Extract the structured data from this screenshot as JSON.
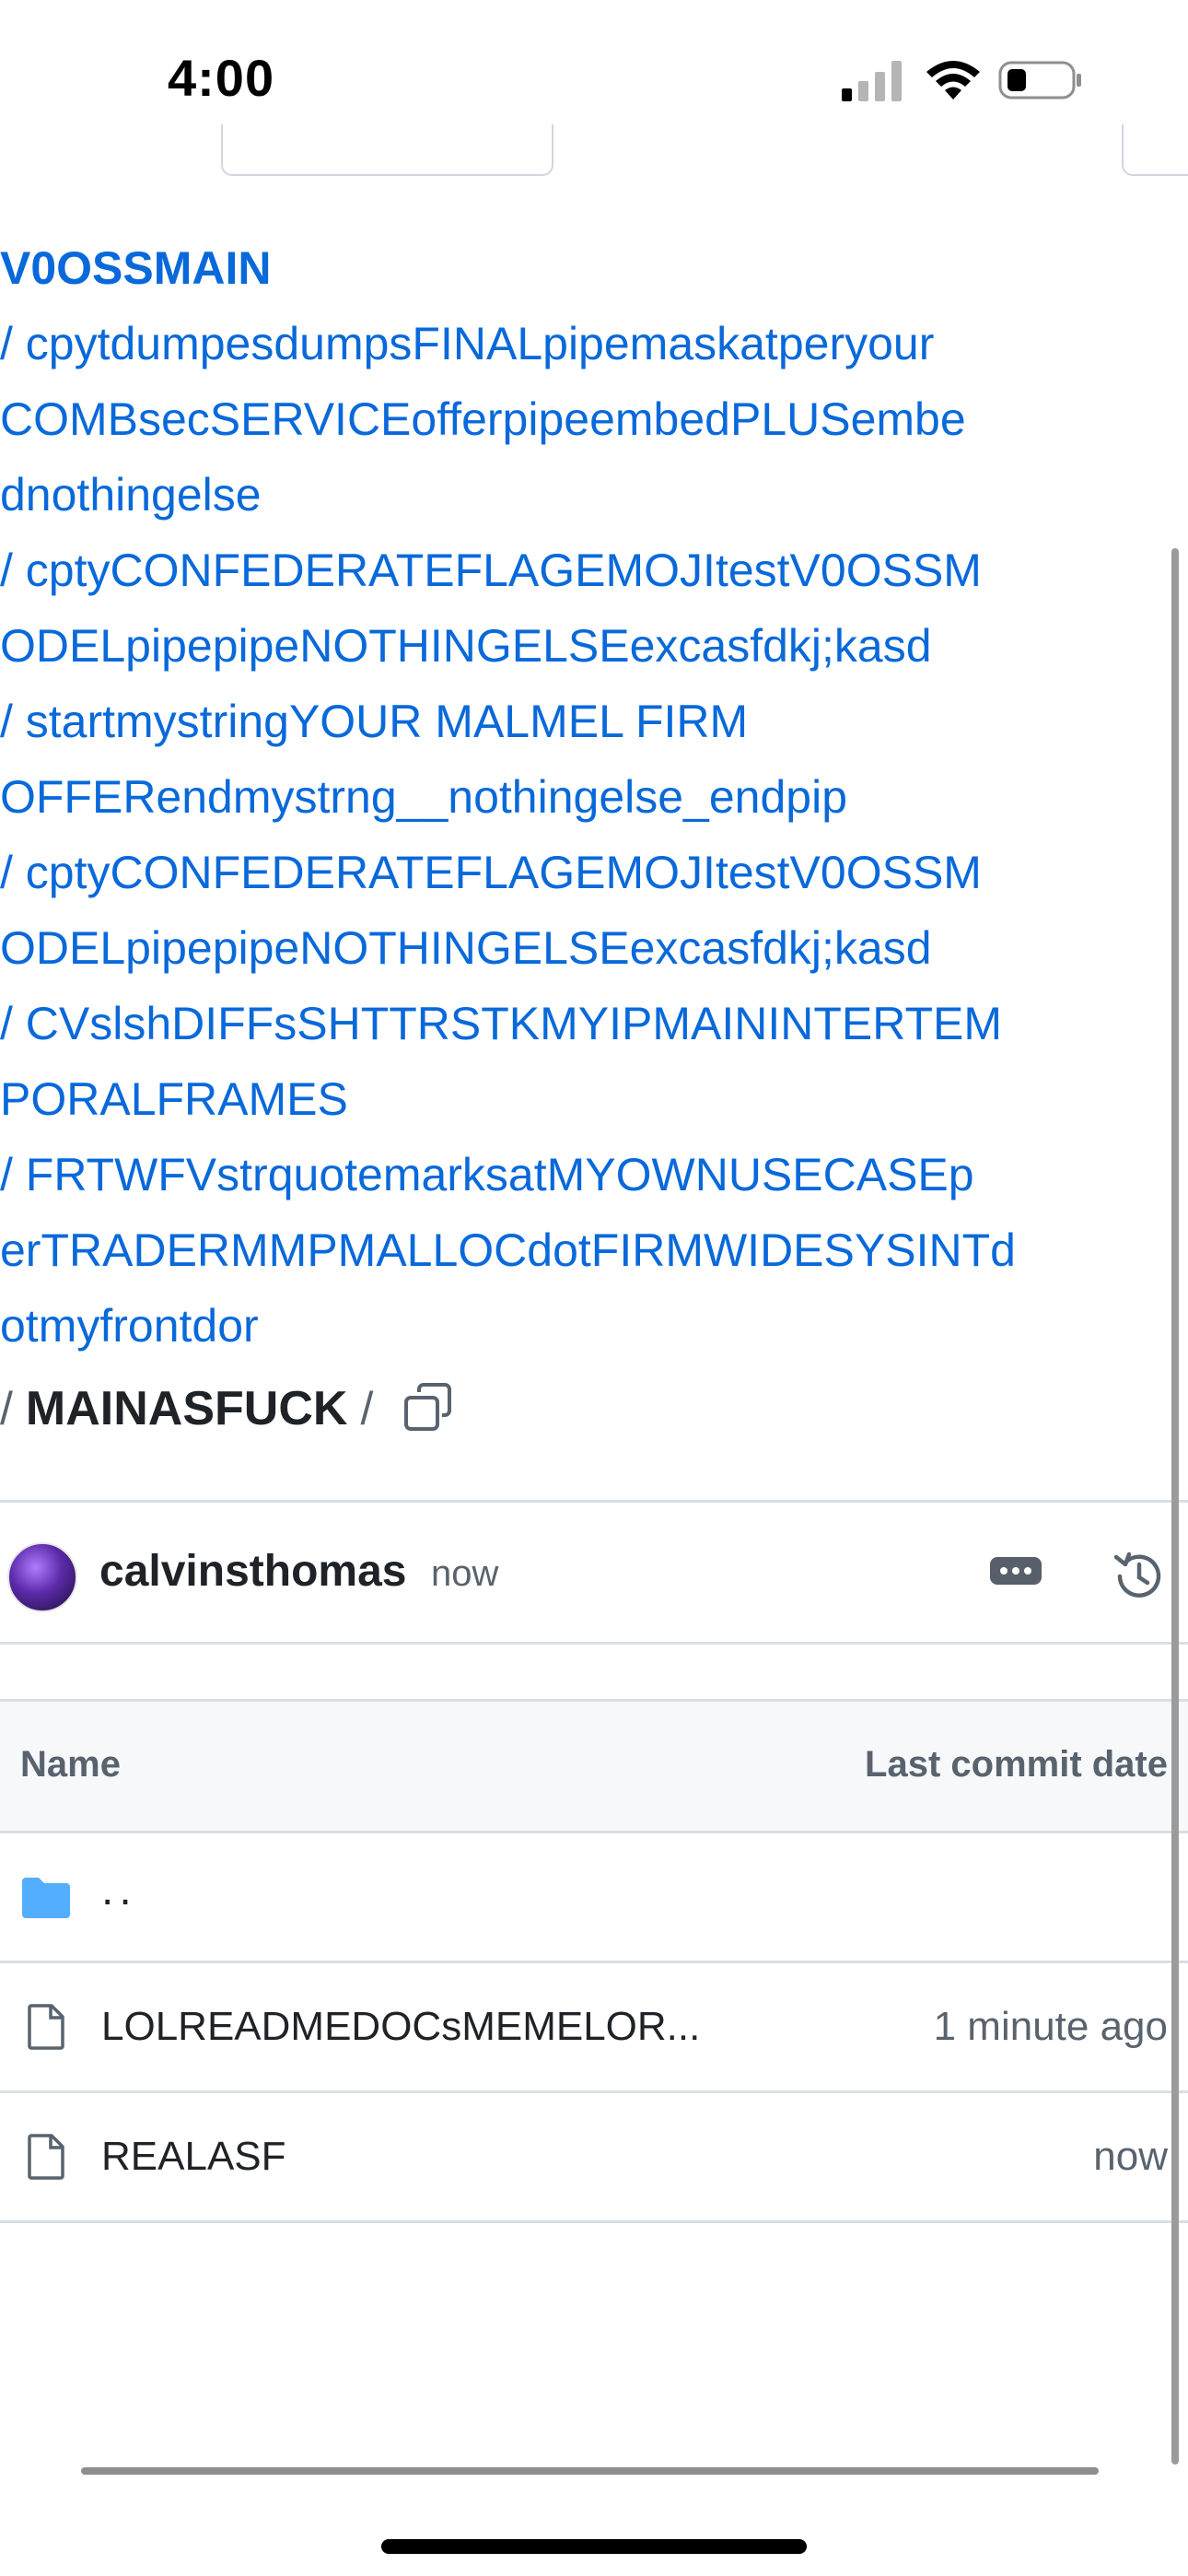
{
  "status_bar": {
    "time": "4:00"
  },
  "breadcrumb": {
    "root": "V0OSSMAIN",
    "separator": "/",
    "lines": [
      "/ cpytdumpesdumpsFINALpipemaskatperyour",
      "COMBsecSERVICEofferpipeembedPLUSembe",
      "dnothingelse",
      "/ cptyCONFEDERATEFLAGEMOJItestV0OSSM",
      "ODELpipepipeNOTHINGELSEexcasfdkj;kasd",
      "/ startmystringYOUR MALMEL FIRM",
      "OFFERendmystrng__nothingelse_endpip",
      "/ cptyCONFEDERATEFLAGEMOJItestV0OSSM",
      "ODELpipepipeNOTHINGELSEexcasfdkj;kasd",
      "/ CVslshDIFFsSHTTRSTKMYIPMAININTERTEM",
      "PORALFRAMES",
      "/ FRTWFVstrquotemarksatMYOWNUSECASEp",
      "erTRADERMMPMALLOCdotFIRMWIDESYSINTd",
      "otmyfrontdor"
    ],
    "current": "MAINASFUCK"
  },
  "commit": {
    "author": "calvinsthomas",
    "time": "now"
  },
  "files": {
    "header": {
      "name": "Name",
      "date": "Last commit date"
    },
    "parent": "..",
    "rows": [
      {
        "name": "LOLREADMEDOCsMEMELOR...",
        "date": "1 minute ago",
        "icon": "file-icon"
      },
      {
        "name": "REALASF",
        "date": "now",
        "icon": "file-icon"
      }
    ]
  },
  "colors": {
    "link": "#0969da",
    "folder": "#54aeff",
    "muted": "#59636e",
    "border": "#d8dee4",
    "header_bg": "#f6f8fa"
  }
}
